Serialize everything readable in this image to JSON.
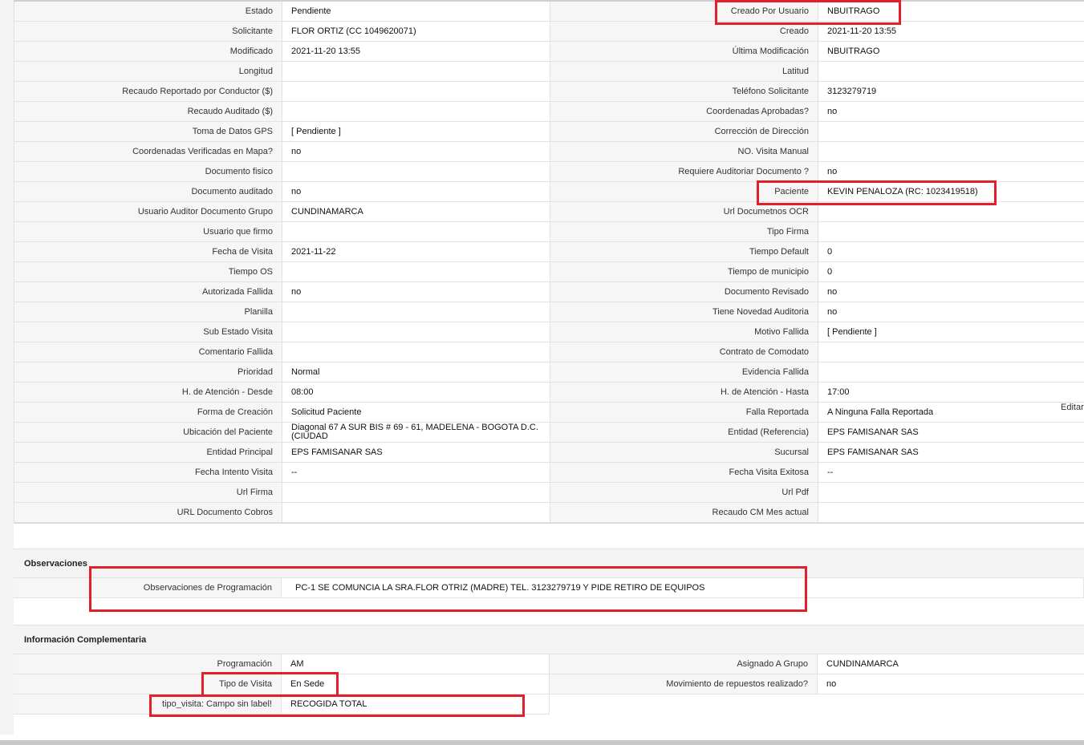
{
  "main_rows": [
    {
      "l1": "Estado",
      "v1": "Pendiente",
      "l2": "Creado Por Usuario",
      "v2": "NBUITRAGO"
    },
    {
      "l1": "Solicitante",
      "v1": "FLOR ORTIZ (CC 1049620071)",
      "l2": "Creado",
      "v2": "2021-11-20 13:55"
    },
    {
      "l1": "Modificado",
      "v1": "2021-11-20 13:55",
      "l2": "Última Modificación",
      "v2": " NBUITRAGO"
    },
    {
      "l1": "Longitud",
      "v1": "",
      "l2": "Latitud",
      "v2": ""
    },
    {
      "l1": "Recaudo Reportado por Conductor ($)",
      "v1": "",
      "l2": "Teléfono Solicitante",
      "v2": "3123279719"
    },
    {
      "l1": "Recaudo Auditado ($)",
      "v1": "",
      "l2": "Coordenadas Aprobadas?",
      "v2": " no"
    },
    {
      "l1": "Toma de Datos GPS",
      "v1": "[ Pendiente ]",
      "l2": "Corrección de Dirección",
      "v2": ""
    },
    {
      "l1": "Coordenadas Verificadas en Mapa?",
      "v1": " no",
      "l2": "NO. Visita Manual",
      "v2": ""
    },
    {
      "l1": "Documento fisico",
      "v1": "",
      "l2": "Requiere Auditoriar Documento ?",
      "v2": " no"
    },
    {
      "l1": "Documento auditado",
      "v1": " no",
      "l2": "Paciente",
      "v2": "KEVIN PENALOZA (RC: 1023419518)"
    },
    {
      "l1": "Usuario Auditor Documento Grupo",
      "v1": "CUNDINAMARCA",
      "l2": "Url Documetnos OCR",
      "v2": ""
    },
    {
      "l1": "Usuario que firmo",
      "v1": "",
      "l2": "Tipo Firma",
      "v2": ""
    },
    {
      "l1": "Fecha de Visita",
      "v1": " 2021-11-22",
      "l2": "Tiempo Default",
      "v2": "0"
    },
    {
      "l1": "Tiempo OS",
      "v1": "",
      "l2": "Tiempo de municipio",
      "v2": "0"
    },
    {
      "l1": "Autorizada Fallida",
      "v1": " no",
      "l2": "Documento Revisado",
      "v2": " no"
    },
    {
      "l1": "Planilla",
      "v1": "",
      "l2": "Tiene Novedad Auditoria",
      "v2": " no"
    },
    {
      "l1": "Sub Estado Visita",
      "v1": "",
      "l2": "Motivo Fallida",
      "v2": "[ Pendiente ]"
    },
    {
      "l1": "Comentario Fallida",
      "v1": "",
      "l2": "Contrato de Comodato",
      "v2": ""
    },
    {
      "l1": "Prioridad",
      "v1": "Normal",
      "l2": "Evidencia Fallida",
      "v2": ""
    },
    {
      "l1": "H. de Atención - Desde",
      "v1": "08:00",
      "l2": "H. de Atención - Hasta",
      "v2": "17:00"
    },
    {
      "l1": "Forma de Creación",
      "v1": "Solicitud Paciente",
      "l2": "Falla Reportada",
      "v2": "A Ninguna Falla Reportada"
    },
    {
      "l1": "Ubicación del Paciente",
      "v1": "Diagonal 67 A SUR BIS # 69 - 61, MADELENA - BOGOTA D.C. (CIUDAD",
      "l2": "Entidad (Referencia)",
      "v2": "EPS FAMISANAR SAS"
    },
    {
      "l1": "Entidad Principal",
      "v1": "EPS FAMISANAR SAS",
      "l2": "Sucursal",
      "v2": "EPS FAMISANAR SAS"
    },
    {
      "l1": "Fecha Intento Visita",
      "v1": "--",
      "l2": "Fecha Visita Exitosa",
      "v2": " --"
    },
    {
      "l1": "Url Firma",
      "v1": "",
      "l2": "Url Pdf",
      "v2": ""
    },
    {
      "l1": "URL Documento Cobros",
      "v1": "",
      "l2": "Recaudo CM Mes actual",
      "v2": ""
    }
  ],
  "edit_link": "Editar",
  "observaciones": {
    "title": "Observaciones",
    "label": "Observaciones de Programación",
    "value": "PC-1 SE COMUNCIA LA SRA.FLOR OTRIZ (MADRE) TEL. 3123279719 Y PIDE RETIRO DE EQUIPOS"
  },
  "complementaria": {
    "title": "Información Complementaria",
    "rows": [
      {
        "l1": "Programación",
        "v1": "AM",
        "l2": "Asignado A Grupo",
        "v2": "CUNDINAMARCA"
      },
      {
        "l1": "Tipo de Visita",
        "v1": "En Sede",
        "l2": "Movimiento de repuestos realizado?",
        "v2": " no"
      },
      {
        "l1": "tipo_visita: Campo sin label!",
        "v1": "RECOGIDA TOTAL",
        "l2": "",
        "v2": ""
      }
    ]
  },
  "highlight_color": "#e0202a"
}
